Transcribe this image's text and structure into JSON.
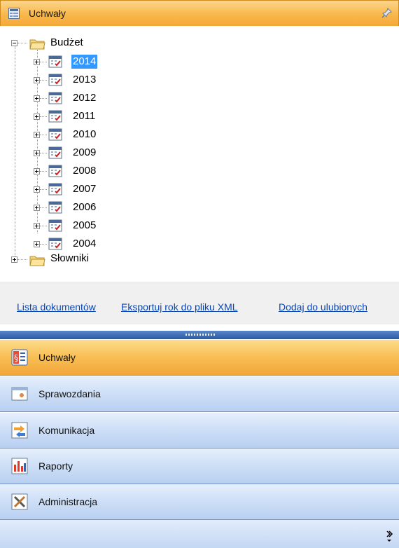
{
  "header": {
    "title": "Uchwały",
    "icon": "table-icon",
    "pin_icon": "pin-icon"
  },
  "tree": {
    "root": {
      "label": "Budżet",
      "expanded": true
    },
    "years": [
      "2014",
      "2013",
      "2012",
      "2011",
      "2010",
      "2009",
      "2008",
      "2007",
      "2006",
      "2005",
      "2004"
    ],
    "selected": "2014",
    "second_root": {
      "label": "Słowniki",
      "expanded": false
    }
  },
  "links": {
    "list_label": "Lista dokumentów",
    "export_label": "Eksportuj rok do pliku XML",
    "fav_label": "Dodaj do ulubionych"
  },
  "nav": [
    {
      "label": "Uchwały",
      "icon": "paragraph-document-icon",
      "active": true
    },
    {
      "label": "Sprawozdania",
      "icon": "report-window-icon",
      "active": false
    },
    {
      "label": "Komunikacja",
      "icon": "exchange-arrows-icon",
      "active": false
    },
    {
      "label": "Raporty",
      "icon": "bar-chart-icon",
      "active": false
    },
    {
      "label": "Administracja",
      "icon": "tools-icon",
      "active": false
    }
  ],
  "colors": {
    "accent": "#f8b84a",
    "selection": "#3399ff",
    "link": "#0a46b4",
    "nav": "#cfe0f7"
  }
}
